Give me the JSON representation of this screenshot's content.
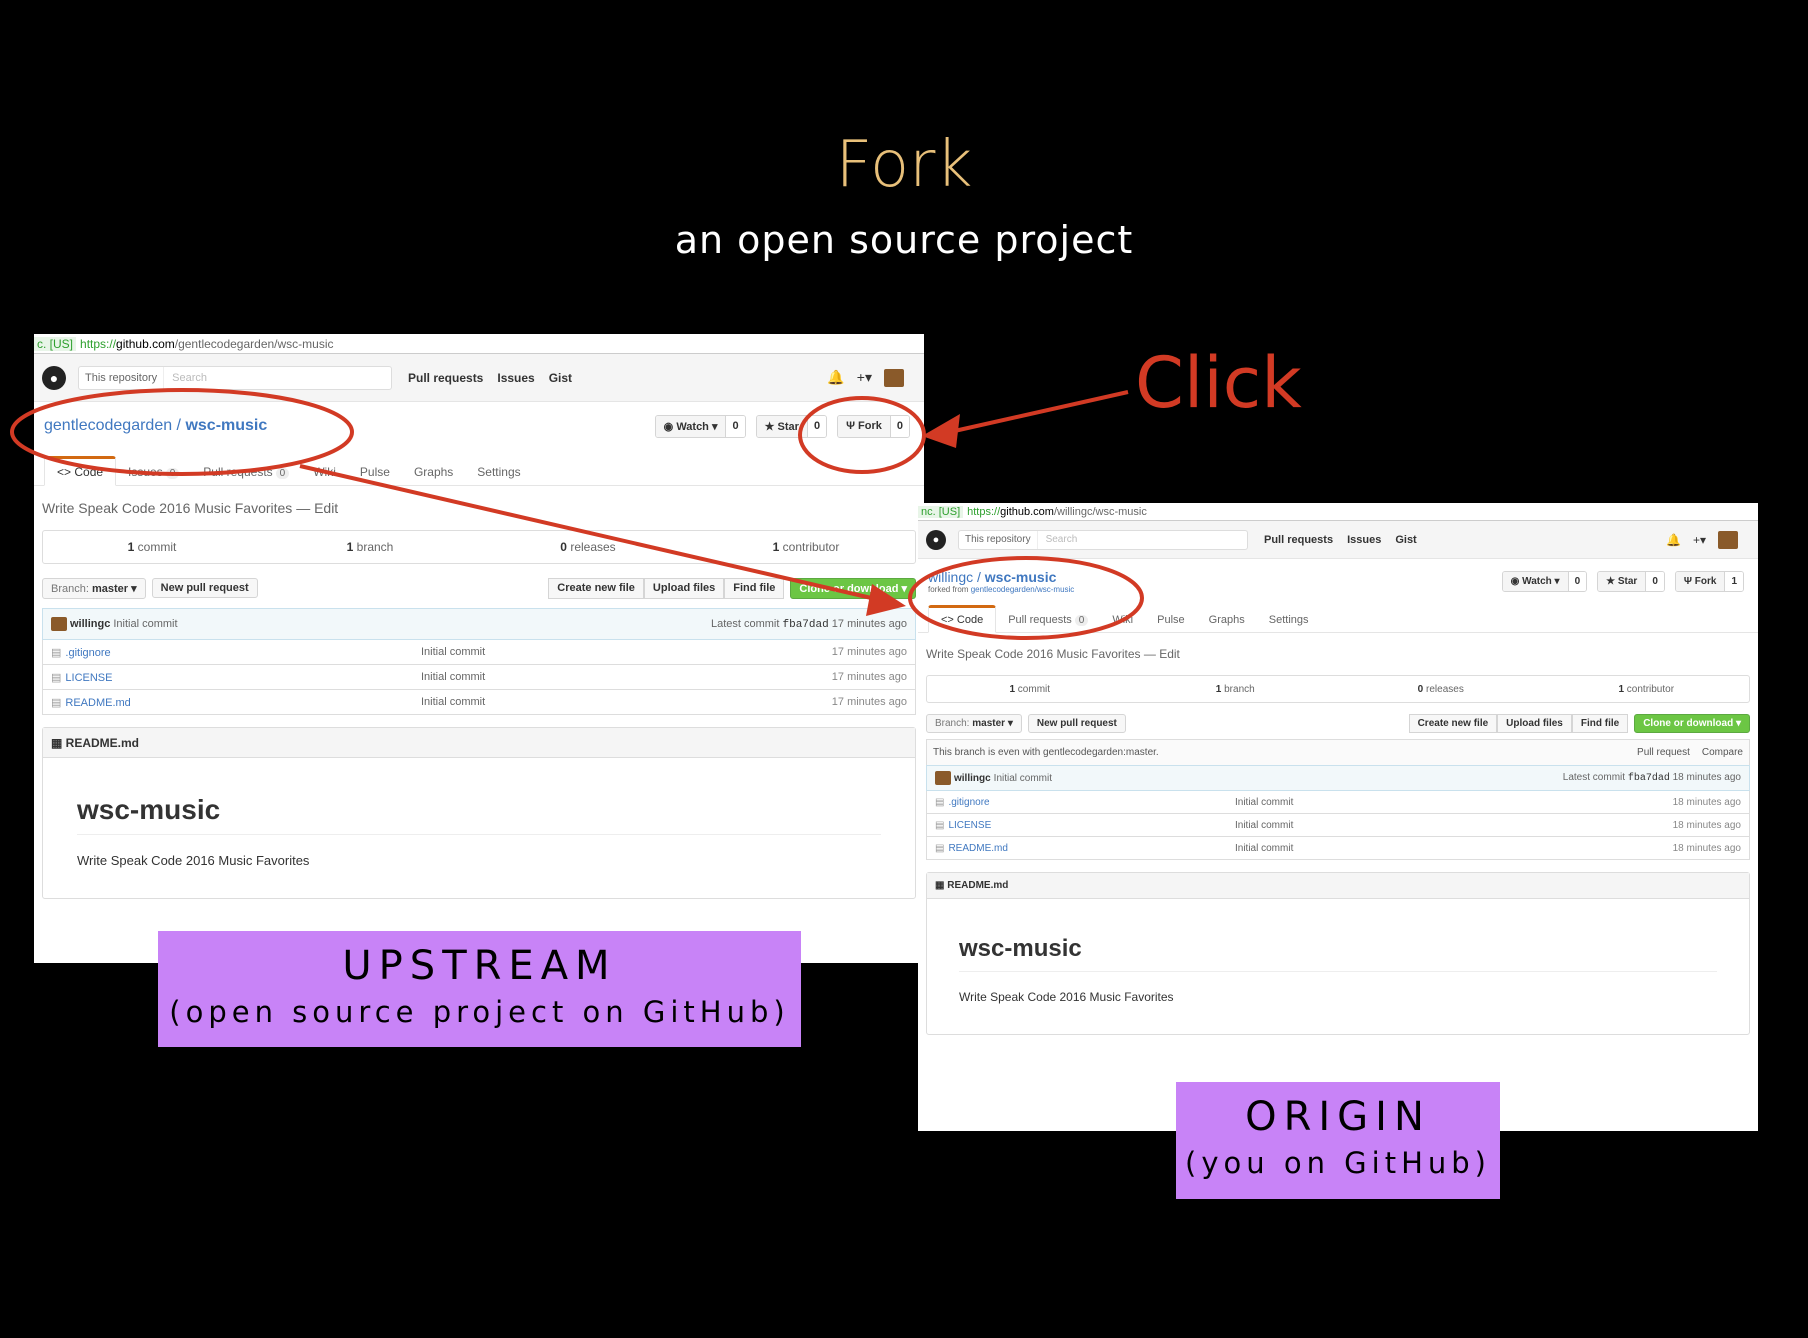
{
  "slide": {
    "title": "Fork",
    "subtitle": "an open source project",
    "click_label": "Click"
  },
  "upstream": {
    "url": {
      "ev": "c. [US]",
      "https": "https://",
      "host": "github.com",
      "path": "/gentlecodegarden/wsc-music"
    },
    "search": {
      "scope": "This repository",
      "placeholder": "Search"
    },
    "nav": [
      "Pull requests",
      "Issues",
      "Gist"
    ],
    "owner": "gentlecodegarden",
    "sep": " / ",
    "repo": "wsc-music",
    "watch": {
      "label": "Watch ▾",
      "count": "0"
    },
    "star": {
      "label": "★ Star",
      "count": "0"
    },
    "fork": {
      "label": "Fork",
      "count": "0"
    },
    "tabs": [
      {
        "label": "<> Code"
      },
      {
        "label": "Issues",
        "count": "0"
      },
      {
        "label": "Pull requests",
        "count": "0"
      },
      {
        "label": "Wiki"
      },
      {
        "label": "Pulse"
      },
      {
        "label": "Graphs"
      },
      {
        "label": "Settings"
      }
    ],
    "description": "Write Speak Code 2016 Music Favorites — Edit",
    "numbers": {
      "commits": "1",
      "commits_label": "commit",
      "branches": "1",
      "branches_label": "branch",
      "releases": "0",
      "releases_label": "releases",
      "contributors": "1",
      "contributors_label": "contributor"
    },
    "branch_label": "Branch:",
    "branch": "master ▾",
    "new_pr": "New pull request",
    "create_file": "Create new file",
    "upload": "Upload files",
    "find": "Find file",
    "clone": "Clone or download ▾",
    "commit": {
      "author": "willingc",
      "message": "Initial commit",
      "latest_label": "Latest commit",
      "sha": "fba7dad",
      "age": "17 minutes ago"
    },
    "files": [
      {
        "name": ".gitignore",
        "msg": "Initial commit",
        "age": "17 minutes ago"
      },
      {
        "name": "LICENSE",
        "msg": "Initial commit",
        "age": "17 minutes ago"
      },
      {
        "name": "README.md",
        "msg": "Initial commit",
        "age": "17 minutes ago"
      }
    ],
    "readme_header": "README.md",
    "readme_title": "wsc-music",
    "readme_text": "Write Speak Code 2016 Music Favorites",
    "label": "UPSTREAM",
    "label_sub": "(open source project on GitHub)"
  },
  "origin": {
    "url": {
      "ev": "nc. [US]",
      "https": "https://",
      "host": "github.com",
      "path": "/willingc/wsc-music"
    },
    "search": {
      "scope": "This repository",
      "placeholder": "Search"
    },
    "nav": [
      "Pull requests",
      "Issues",
      "Gist"
    ],
    "owner": "willingc",
    "sep": " / ",
    "repo": "wsc-music",
    "forked_from_label": "forked from ",
    "forked_from": "gentlecodegarden/wsc-music",
    "watch": {
      "label": "Watch ▾",
      "count": "0"
    },
    "star": {
      "label": "★ Star",
      "count": "0"
    },
    "fork": {
      "label": "Fork",
      "count": "1"
    },
    "tabs": [
      {
        "label": "<> Code"
      },
      {
        "label": "Pull requests",
        "count": "0"
      },
      {
        "label": "Wiki"
      },
      {
        "label": "Pulse"
      },
      {
        "label": "Graphs"
      },
      {
        "label": "Settings"
      }
    ],
    "description": "Write Speak Code 2016 Music Favorites — Edit",
    "numbers": {
      "commits": "1",
      "commits_label": "commit",
      "branches": "1",
      "branches_label": "branch",
      "releases": "0",
      "releases_label": "releases",
      "contributors": "1",
      "contributors_label": "contributor"
    },
    "branch_label": "Branch:",
    "branch": "master ▾",
    "new_pr": "New pull request",
    "create_file": "Create new file",
    "upload": "Upload files",
    "find": "Find file",
    "clone": "Clone or download ▾",
    "even_text": "This branch is even with gentlecodegarden:master.",
    "even_pr": "Pull request",
    "even_compare": "Compare",
    "commit": {
      "author": "willingc",
      "message": "Initial commit",
      "latest_label": "Latest commit",
      "sha": "fba7dad",
      "age": "18 minutes ago"
    },
    "files": [
      {
        "name": ".gitignore",
        "msg": "Initial commit",
        "age": "18 minutes ago"
      },
      {
        "name": "LICENSE",
        "msg": "Initial commit",
        "age": "18 minutes ago"
      },
      {
        "name": "README.md",
        "msg": "Initial commit",
        "age": "18 minutes ago"
      }
    ],
    "readme_header": "README.md",
    "readme_title": "wsc-music",
    "readme_text": "Write Speak Code 2016 Music Favorites",
    "label": "ORIGIN",
    "label_sub": "(you on GitHub)"
  },
  "colors": {
    "title": "#e8c07a",
    "annotation": "#d23a24",
    "label_bg": "#c883f7",
    "link": "#4078c0",
    "clone": "#6cc644"
  },
  "icons": [
    "github-logo-icon",
    "bell-icon",
    "plus-icon",
    "eye-icon",
    "star-icon",
    "fork-icon",
    "code-icon",
    "book-icon",
    "file-icon"
  ]
}
